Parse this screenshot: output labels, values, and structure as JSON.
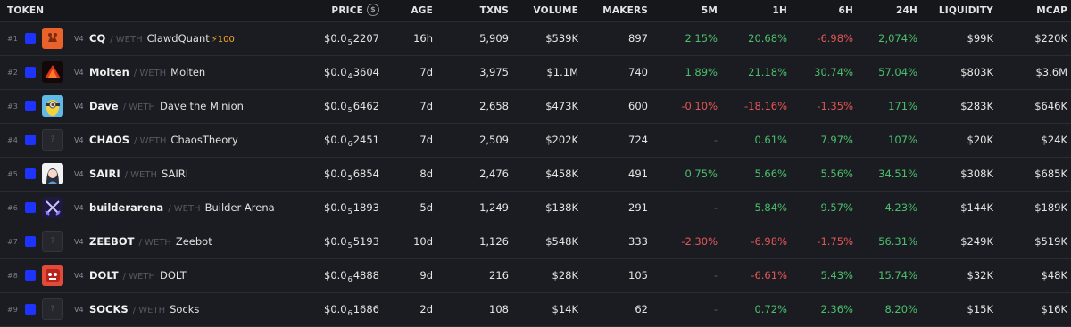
{
  "header": {
    "token": "TOKEN",
    "price": "PRICE",
    "price_icon": "$",
    "age": "AGE",
    "txns": "TXNS",
    "volume": "VOLUME",
    "makers": "MAKERS",
    "m5": "5M",
    "h1": "1H",
    "h6": "6H",
    "h24": "24H",
    "liquidity": "LIQUIDITY",
    "mcap": "MCAP"
  },
  "colors": {
    "positive": "#4ac06b",
    "negative": "#e25656",
    "select": "#1f33ff"
  },
  "rows": [
    {
      "rank": "#1",
      "version": "V4",
      "symbol": "CQ",
      "pair": "/ WETH",
      "name": "ClawdQuant",
      "boost": "⚡100",
      "logo": "claw-logo",
      "price_pre": "$0.0",
      "price_sub": "5",
      "price_digits": "2207",
      "age": "16h",
      "txns": "5,909",
      "volume": "$539K",
      "makers": "897",
      "m5": "2.15%",
      "h1": "20.68%",
      "h6": "-6.98%",
      "h24": "2,074%",
      "liquidity": "$99K",
      "mcap": "$220K"
    },
    {
      "rank": "#2",
      "version": "V4",
      "symbol": "Molten",
      "pair": "/ WETH",
      "name": "Molten",
      "boost": "",
      "logo": "molten-logo",
      "price_pre": "$0.0",
      "price_sub": "4",
      "price_digits": "3604",
      "age": "7d",
      "txns": "3,975",
      "volume": "$1.1M",
      "makers": "740",
      "m5": "1.89%",
      "h1": "21.18%",
      "h6": "30.74%",
      "h24": "57.04%",
      "liquidity": "$803K",
      "mcap": "$3.6M"
    },
    {
      "rank": "#3",
      "version": "V4",
      "symbol": "Dave",
      "pair": "/ WETH",
      "name": "Dave the Minion",
      "boost": "",
      "logo": "minion-logo",
      "price_pre": "$0.0",
      "price_sub": "5",
      "price_digits": "6462",
      "age": "7d",
      "txns": "2,658",
      "volume": "$473K",
      "makers": "600",
      "m5": "-0.10%",
      "h1": "-18.16%",
      "h6": "-1.35%",
      "h24": "171%",
      "liquidity": "$283K",
      "mcap": "$646K"
    },
    {
      "rank": "#4",
      "version": "V4",
      "symbol": "CHAOS",
      "pair": "/ WETH",
      "name": "ChaosTheory",
      "boost": "",
      "logo": "placeholder-logo",
      "price_pre": "$0.0",
      "price_sub": "6",
      "price_digits": "2451",
      "age": "7d",
      "txns": "2,509",
      "volume": "$202K",
      "makers": "724",
      "m5": "-",
      "h1": "0.61%",
      "h6": "7.97%",
      "h24": "107%",
      "liquidity": "$20K",
      "mcap": "$24K"
    },
    {
      "rank": "#5",
      "version": "V4",
      "symbol": "SAIRI",
      "pair": "/ WETH",
      "name": "SAIRI",
      "boost": "",
      "logo": "avatar-logo",
      "price_pre": "$0.0",
      "price_sub": "5",
      "price_digits": "6854",
      "age": "8d",
      "txns": "2,476",
      "volume": "$458K",
      "makers": "491",
      "m5": "0.75%",
      "h1": "5.66%",
      "h6": "5.56%",
      "h24": "34.51%",
      "liquidity": "$308K",
      "mcap": "$685K"
    },
    {
      "rank": "#6",
      "version": "V4",
      "symbol": "builderarena",
      "pair": "/ WETH",
      "name": "Builder Arena",
      "boost": "",
      "logo": "swords-logo",
      "price_pre": "$0.0",
      "price_sub": "5",
      "price_digits": "1893",
      "age": "5d",
      "txns": "1,249",
      "volume": "$138K",
      "makers": "291",
      "m5": "-",
      "h1": "5.84%",
      "h6": "9.57%",
      "h24": "4.23%",
      "liquidity": "$144K",
      "mcap": "$189K"
    },
    {
      "rank": "#7",
      "version": "V4",
      "symbol": "ZEEBOT",
      "pair": "/ WETH",
      "name": "Zeebot",
      "boost": "",
      "logo": "placeholder-logo",
      "price_pre": "$0.0",
      "price_sub": "5",
      "price_digits": "5193",
      "age": "10d",
      "txns": "1,126",
      "volume": "$548K",
      "makers": "333",
      "m5": "-2.30%",
      "h1": "-6.98%",
      "h6": "-1.75%",
      "h24": "56.31%",
      "liquidity": "$249K",
      "mcap": "$519K"
    },
    {
      "rank": "#8",
      "version": "V4",
      "symbol": "DOLT",
      "pair": "/ WETH",
      "name": "DOLT",
      "boost": "",
      "logo": "monster-logo",
      "price_pre": "$0.0",
      "price_sub": "6",
      "price_digits": "4888",
      "age": "9d",
      "txns": "216",
      "volume": "$28K",
      "makers": "105",
      "m5": "-",
      "h1": "-6.61%",
      "h6": "5.43%",
      "h24": "15.74%",
      "liquidity": "$32K",
      "mcap": "$48K"
    },
    {
      "rank": "#9",
      "version": "V4",
      "symbol": "SOCKS",
      "pair": "/ WETH",
      "name": "Socks",
      "boost": "",
      "logo": "placeholder-logo",
      "price_pre": "$0.0",
      "price_sub": "6",
      "price_digits": "1686",
      "age": "2d",
      "txns": "108",
      "volume": "$14K",
      "makers": "62",
      "m5": "-",
      "h1": "0.72%",
      "h6": "2.36%",
      "h24": "8.20%",
      "liquidity": "$15K",
      "mcap": "$16K"
    }
  ]
}
